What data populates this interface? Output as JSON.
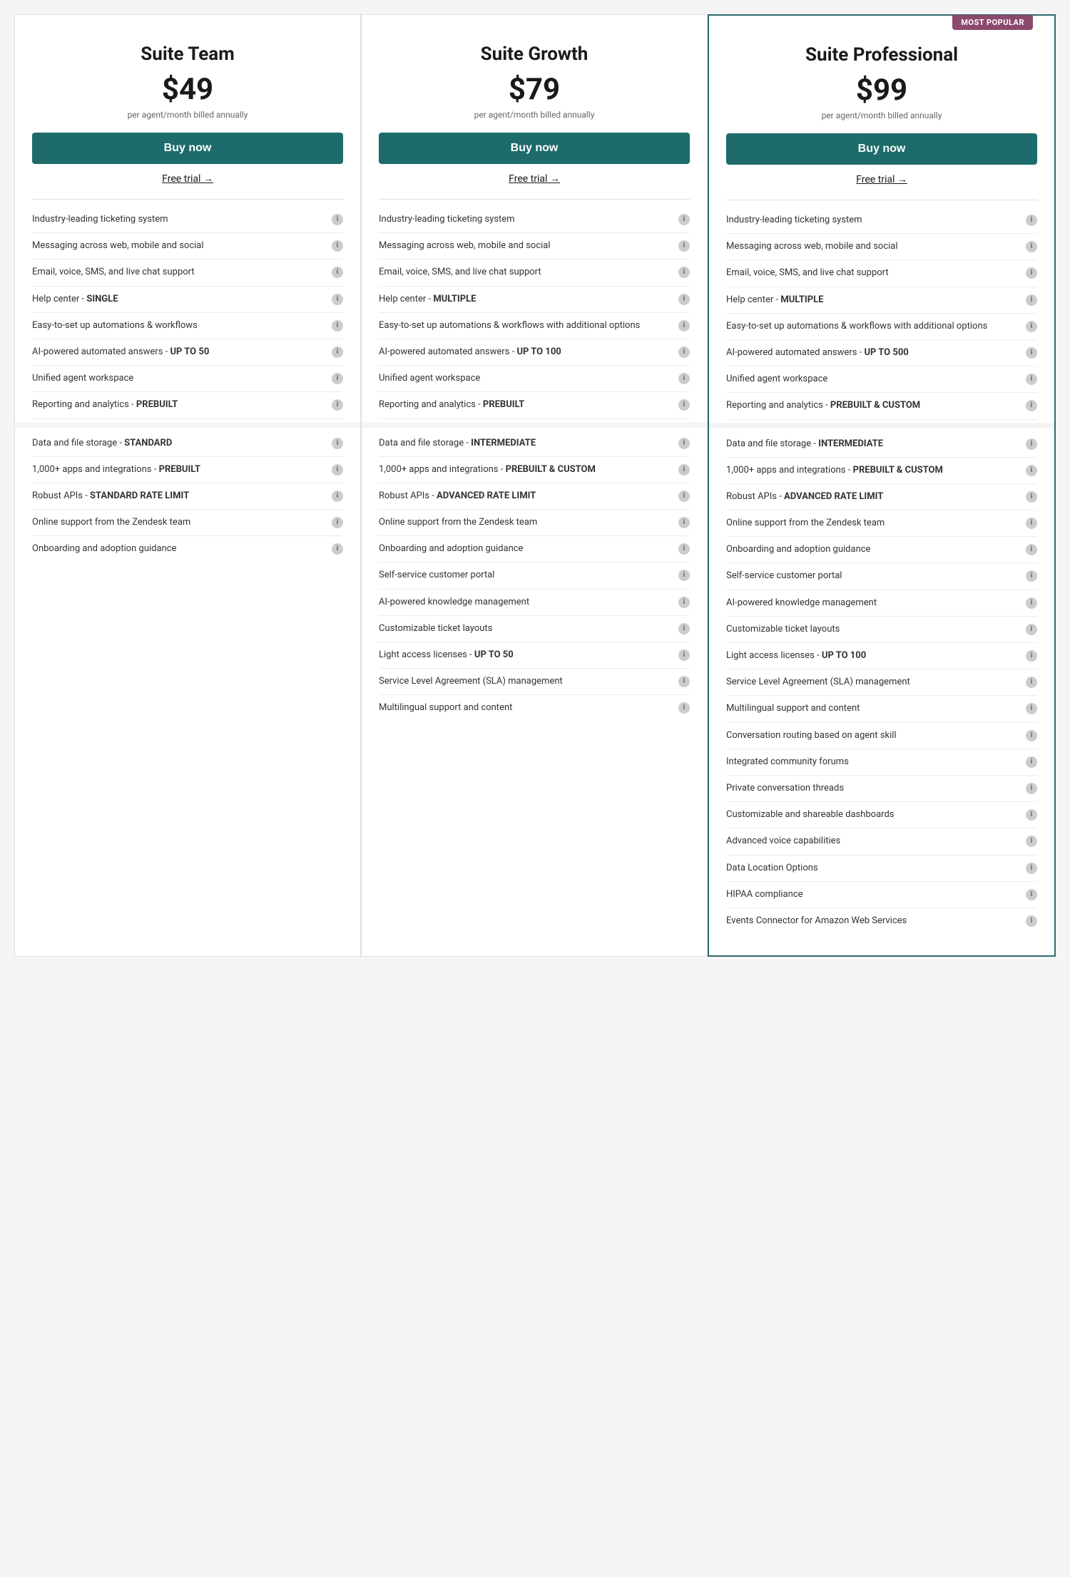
{
  "plans": [
    {
      "id": "suite-team",
      "name": "Suite Team",
      "price": "$49",
      "billing": "per agent/month billed annually",
      "buy_label": "Buy now",
      "free_trial_label": "Free trial →",
      "featured": false,
      "most_popular": "",
      "features": [
        {
          "text": "Industry-leading ticketing system",
          "bold_part": ""
        },
        {
          "text": "Messaging across web, mobile and social",
          "bold_part": ""
        },
        {
          "text": "Email, voice, SMS, and live chat support",
          "bold_part": ""
        },
        {
          "text": "Help center - ",
          "bold_part": "SINGLE"
        },
        {
          "text": "Easy-to-set up automations & workflows",
          "bold_part": ""
        },
        {
          "text": "AI-powered automated answers - ",
          "bold_part": "UP TO 50"
        },
        {
          "text": "Unified agent workspace",
          "bold_part": ""
        },
        {
          "text": "Reporting and analytics - ",
          "bold_part": "PREBUILT"
        },
        {
          "text": "Data and file storage - ",
          "bold_part": "STANDARD",
          "section_gap": true
        },
        {
          "text": "1,000+ apps and integrations - ",
          "bold_part": "PREBUILT"
        },
        {
          "text": "Robust APIs - ",
          "bold_part": "STANDARD RATE LIMIT"
        },
        {
          "text": "Online support from the Zendesk team",
          "bold_part": ""
        },
        {
          "text": "Onboarding and adoption guidance",
          "bold_part": ""
        }
      ]
    },
    {
      "id": "suite-growth",
      "name": "Suite Growth",
      "price": "$79",
      "billing": "per agent/month billed annually",
      "buy_label": "Buy now",
      "free_trial_label": "Free trial →",
      "featured": false,
      "most_popular": "",
      "features": [
        {
          "text": "Industry-leading ticketing system",
          "bold_part": ""
        },
        {
          "text": "Messaging across web, mobile and social",
          "bold_part": ""
        },
        {
          "text": "Email, voice, SMS, and live chat support",
          "bold_part": ""
        },
        {
          "text": "Help center - ",
          "bold_part": "MULTIPLE"
        },
        {
          "text": "Easy-to-set up automations & workflows with additional options",
          "bold_part": ""
        },
        {
          "text": "AI-powered automated answers - ",
          "bold_part": "UP TO 100"
        },
        {
          "text": "Unified agent workspace",
          "bold_part": ""
        },
        {
          "text": "Reporting and analytics - ",
          "bold_part": "PREBUILT"
        },
        {
          "text": "Data and file storage - ",
          "bold_part": "INTERMEDIATE",
          "section_gap": true
        },
        {
          "text": "1,000+ apps and integrations - ",
          "bold_part": "PREBUILT & CUSTOM"
        },
        {
          "text": "Robust APIs - ",
          "bold_part": "ADVANCED RATE LIMIT"
        },
        {
          "text": "Online support from the Zendesk team",
          "bold_part": ""
        },
        {
          "text": "Onboarding and adoption guidance",
          "bold_part": ""
        },
        {
          "text": "Self-service customer portal",
          "bold_part": ""
        },
        {
          "text": "AI-powered knowledge management",
          "bold_part": ""
        },
        {
          "text": "Customizable ticket layouts",
          "bold_part": ""
        },
        {
          "text": "Light access licenses - ",
          "bold_part": "UP TO 50"
        },
        {
          "text": "Service Level Agreement (SLA) management",
          "bold_part": ""
        },
        {
          "text": "Multilingual support and content",
          "bold_part": ""
        }
      ]
    },
    {
      "id": "suite-professional",
      "name": "Suite Professional",
      "price": "$99",
      "billing": "per agent/month billed annually",
      "buy_label": "Buy now",
      "free_trial_label": "Free trial →",
      "featured": true,
      "most_popular": "Most popular",
      "features": [
        {
          "text": "Industry-leading ticketing system",
          "bold_part": ""
        },
        {
          "text": "Messaging across web, mobile and social",
          "bold_part": ""
        },
        {
          "text": "Email, voice, SMS, and live chat support",
          "bold_part": ""
        },
        {
          "text": "Help center - ",
          "bold_part": "MULTIPLE"
        },
        {
          "text": "Easy-to-set up automations & workflows with additional options",
          "bold_part": ""
        },
        {
          "text": "AI-powered automated answers - ",
          "bold_part": "UP TO 500"
        },
        {
          "text": "Unified agent workspace",
          "bold_part": ""
        },
        {
          "text": "Reporting and analytics - ",
          "bold_part": "PREBUILT & CUSTOM"
        },
        {
          "text": "Data and file storage - ",
          "bold_part": "INTERMEDIATE",
          "section_gap": true
        },
        {
          "text": "1,000+ apps and integrations - ",
          "bold_part": "PREBUILT & CUSTOM"
        },
        {
          "text": "Robust APIs - ",
          "bold_part": "ADVANCED RATE LIMIT"
        },
        {
          "text": "Online support from the Zendesk team",
          "bold_part": ""
        },
        {
          "text": "Onboarding and adoption guidance",
          "bold_part": ""
        },
        {
          "text": "Self-service customer portal",
          "bold_part": ""
        },
        {
          "text": "AI-powered knowledge management",
          "bold_part": ""
        },
        {
          "text": "Customizable ticket layouts",
          "bold_part": ""
        },
        {
          "text": "Light access licenses - ",
          "bold_part": "UP TO 100"
        },
        {
          "text": "Service Level Agreement (SLA) management",
          "bold_part": ""
        },
        {
          "text": "Multilingual support and content",
          "bold_part": ""
        },
        {
          "text": "Conversation routing based on agent skill",
          "bold_part": ""
        },
        {
          "text": "Integrated community forums",
          "bold_part": ""
        },
        {
          "text": "Private conversation threads",
          "bold_part": ""
        },
        {
          "text": "Customizable and shareable dashboards",
          "bold_part": ""
        },
        {
          "text": "Advanced voice capabilities",
          "bold_part": ""
        },
        {
          "text": "Data Location Options",
          "bold_part": ""
        },
        {
          "text": "HIPAA compliance",
          "bold_part": ""
        },
        {
          "text": "Events Connector for Amazon Web Services",
          "bold_part": ""
        }
      ]
    }
  ]
}
